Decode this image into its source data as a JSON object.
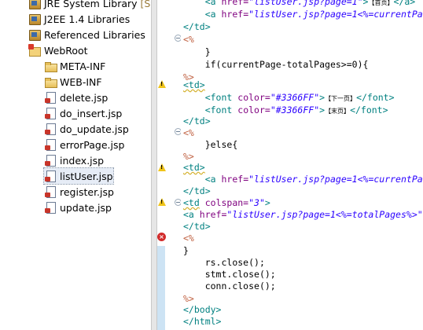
{
  "tree": {
    "items": [
      {
        "label": "JRE System Library",
        "suffix": "[Su",
        "icon": "library-icon"
      },
      {
        "label": "J2EE 1.4 Libraries",
        "suffix": "",
        "icon": "library-icon"
      },
      {
        "label": "Referenced Libraries",
        "suffix": "",
        "icon": "library-icon"
      },
      {
        "label": "WebRoot",
        "suffix": "",
        "icon": "webroot-folder-icon"
      },
      {
        "label": "META-INF",
        "suffix": "",
        "icon": "folder-icon"
      },
      {
        "label": "WEB-INF",
        "suffix": "",
        "icon": "folder-icon"
      },
      {
        "label": "delete.jsp",
        "suffix": "",
        "icon": "jsp-file-icon"
      },
      {
        "label": "do_insert.jsp",
        "suffix": "",
        "icon": "jsp-file-icon"
      },
      {
        "label": "do_update.jsp",
        "suffix": "",
        "icon": "jsp-file-icon"
      },
      {
        "label": "errorPage.jsp",
        "suffix": "",
        "icon": "jsp-file-icon"
      },
      {
        "label": "index.jsp",
        "suffix": "",
        "icon": "jsp-file-icon"
      },
      {
        "label": "listUser.jsp",
        "suffix": "",
        "icon": "jsp-file-icon"
      },
      {
        "label": "register.jsp",
        "suffix": "",
        "icon": "jsp-file-icon"
      },
      {
        "label": "update.jsp",
        "suffix": "",
        "icon": "jsp-file-icon"
      }
    ]
  },
  "editor": {
    "tokens": {
      "href_attr": "href=",
      "list_page1": "\"listUser.jsp?page=1\"",
      "list_page1_open": "\"listUser.jsp?page=1<%=currentPa",
      "first_cjk": "【首页】",
      "close_a": "</a>",
      "a_open": "<a",
      "gt": ">",
      "td_close": "</td>",
      "jsp_open": "<%",
      "jsp_close": "%>",
      "brace_close": "}",
      "if_stmt": "if(currentPage-totalPages>=0){",
      "td_open": "<td>",
      "font_open": "<font",
      "color_attr": "color=",
      "color_val": "\"#3366FF\"",
      "next_cjk": "【下一页】",
      "last_cjk": "【末页】",
      "font_close": "</font>",
      "else_stmt": "}else{",
      "td_colspan_open": "<td",
      "colspan_attr": "colspan=",
      "colspan_val": "\"3\"",
      "total_pages_href": "\"listUser.jsp?page=1<%=totalPages%>\"",
      "rs_close": "rs.close();",
      "stmt_close": "stmt.close();",
      "conn_close": "conn.close();",
      "body_close": "</body>",
      "html_close": "</html>"
    }
  },
  "colors": {
    "tag": "#008080",
    "attr": "#7f007f",
    "string": "#2a00ff",
    "jsp_delim": "#bf5f3f",
    "current_line": "#e8f2fe"
  }
}
